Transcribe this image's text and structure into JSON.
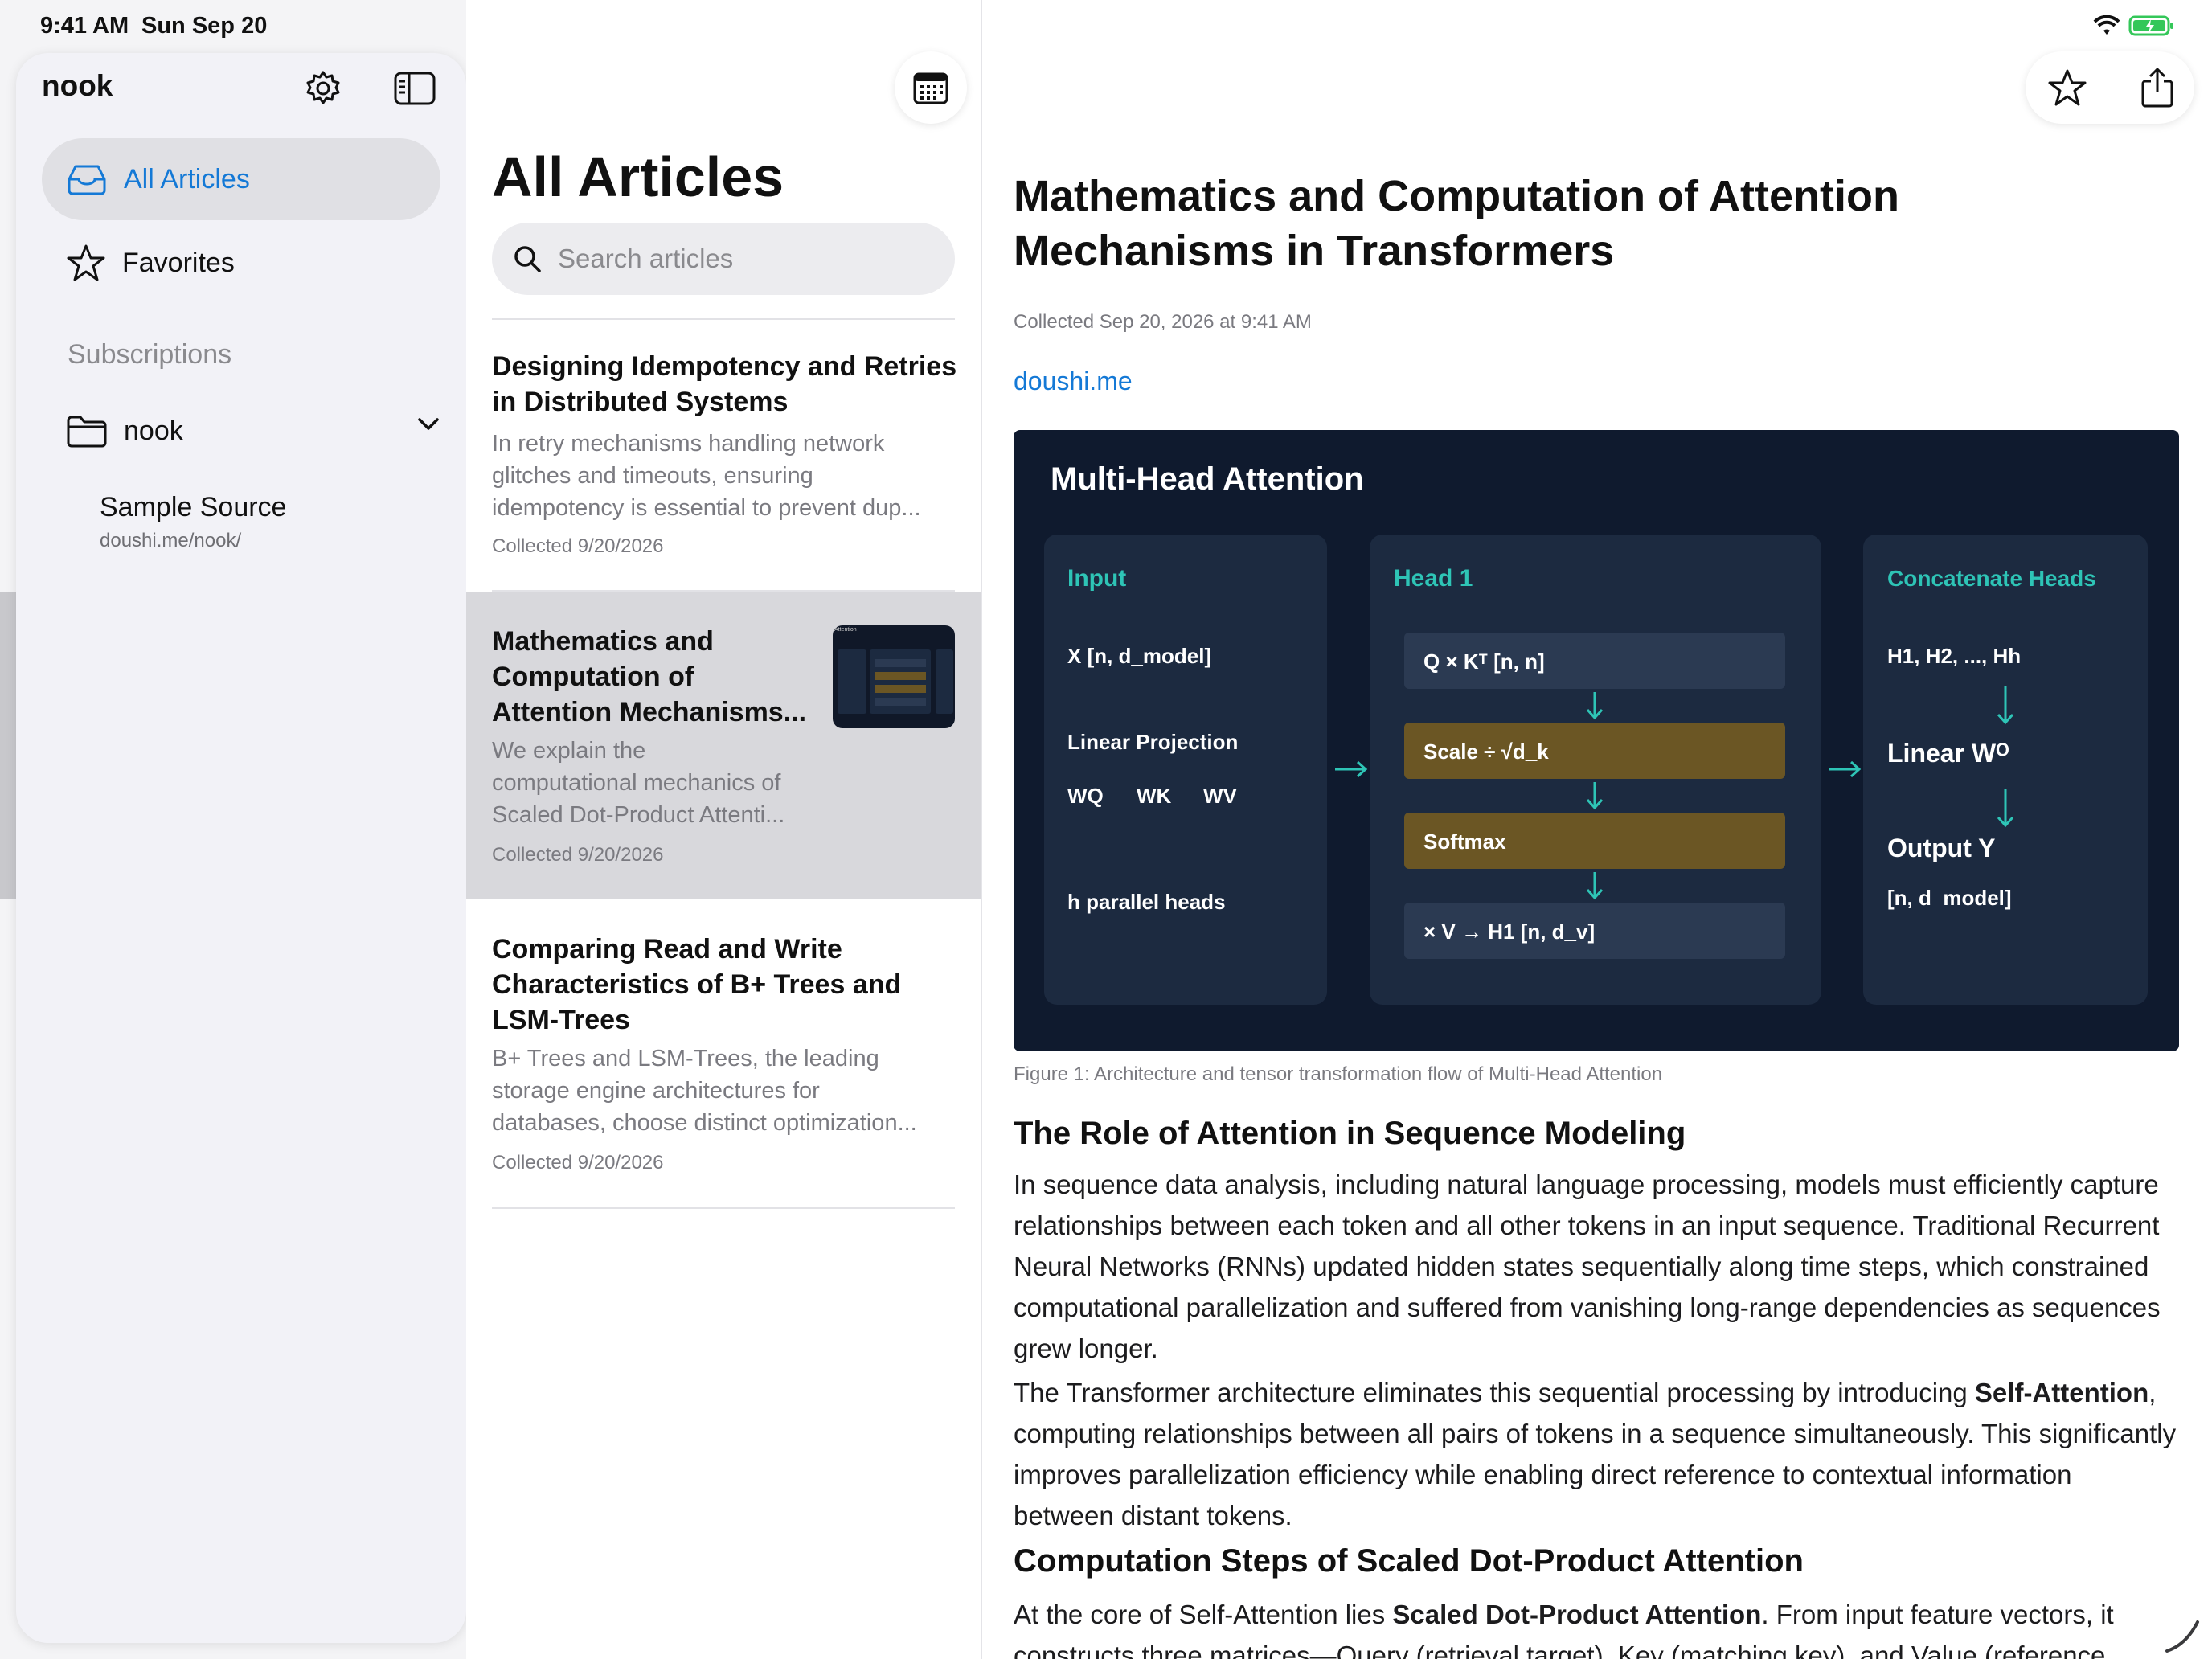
{
  "status": {
    "time": "9:41 AM",
    "date": "Sun Sep 20"
  },
  "sidebar": {
    "title": "nook",
    "items": [
      {
        "label": "All Articles",
        "icon": "tray-icon",
        "active": true
      },
      {
        "label": "Favorites",
        "icon": "star-icon",
        "active": false
      }
    ],
    "section_label": "Subscriptions",
    "folder": {
      "label": "nook",
      "icon": "folder-icon"
    },
    "source": {
      "name": "Sample Source",
      "url": "doushi.me/nook/"
    }
  },
  "list": {
    "title": "All Articles",
    "search_placeholder": "Search articles",
    "articles": [
      {
        "title_lines": [
          "Designing Idempotency and Retries",
          "in Distributed Systems"
        ],
        "summary_lines": [
          "In retry mechanisms handling network",
          "glitches and timeouts, ensuring",
          "idempotency is essential to prevent dup..."
        ],
        "collected": "Collected 9/20/2026"
      },
      {
        "title_lines": [
          "Mathematics and",
          "Computation of",
          "Attention Mechanisms..."
        ],
        "summary_lines": [
          "We explain the",
          "computational mechanics of",
          "Scaled Dot-Product Attenti..."
        ],
        "collected": "Collected 9/20/2026",
        "thumb_label": "Attention"
      },
      {
        "title_lines": [
          "Comparing Read and Write",
          "Characteristics of B+ Trees and",
          "LSM-Trees"
        ],
        "summary_lines": [
          "B+ Trees and LSM-Trees, the leading",
          "storage engine architectures for",
          "databases, choose distinct optimization..."
        ],
        "collected": "Collected 9/20/2026"
      }
    ]
  },
  "reader": {
    "title_lines": [
      "Mathematics and Computation of Attention",
      "Mechanisms in Transformers"
    ],
    "meta": "Collected Sep 20, 2026 at 9:41 AM",
    "link": "doushi.me",
    "figure": {
      "title": "Multi-Head Attention",
      "input": {
        "heading": "Input",
        "shape": "X  [n, d_model]",
        "proj": "Linear Projection",
        "w": [
          "WQ",
          "WK",
          "WV"
        ],
        "heads": "h parallel heads"
      },
      "head": {
        "heading": "Head 1",
        "steps": [
          "Q × Kᵀ   [n, n]",
          "Scale  ÷ √d_k",
          "Softmax",
          "× V   →   H1 [n, d_v]"
        ]
      },
      "concat": {
        "heading": "Concatenate Heads",
        "items": [
          "H1, H2, ..., Hh",
          "Linear Wᴼ",
          "Output Y",
          "[n, d_model]"
        ]
      },
      "caption": "Figure 1: Architecture and tensor transformation flow of Multi-Head Attention"
    },
    "section1": {
      "heading": "The Role of Attention in Sequence Modeling",
      "p1": "In sequence data analysis, including natural language processing, models must efficiently capture relationships between each token and all other tokens in an input sequence. Traditional Recurrent Neural Networks (RNNs) updated hidden states sequentially along time steps, which constrained computational parallelization and suffered from vanishing long-range dependencies as sequences grew longer.",
      "p2a": "The Transformer architecture eliminates this sequential processing by introducing ",
      "p2b": "Self-Attention",
      "p2c": ", computing relationships between all pairs of tokens in a sequence simultaneously. This significantly improves parallelization efficiency while enabling direct reference to contextual information between distant tokens."
    },
    "section2": {
      "heading": "Computation Steps of Scaled Dot-Product Attention",
      "p1a": "At the core of Self-Attention lies ",
      "p1b": "Scaled Dot-Product Attention",
      "p1c": ". From input feature vectors, it constructs three matrices—Query (retrieval target), Key (matching key), and Value (reference"
    },
    "colors": {
      "accent": "#1479d6",
      "figure_bg": "#0f1a2e",
      "teal": "#2ec4b6",
      "gold": "#6b5624"
    }
  }
}
